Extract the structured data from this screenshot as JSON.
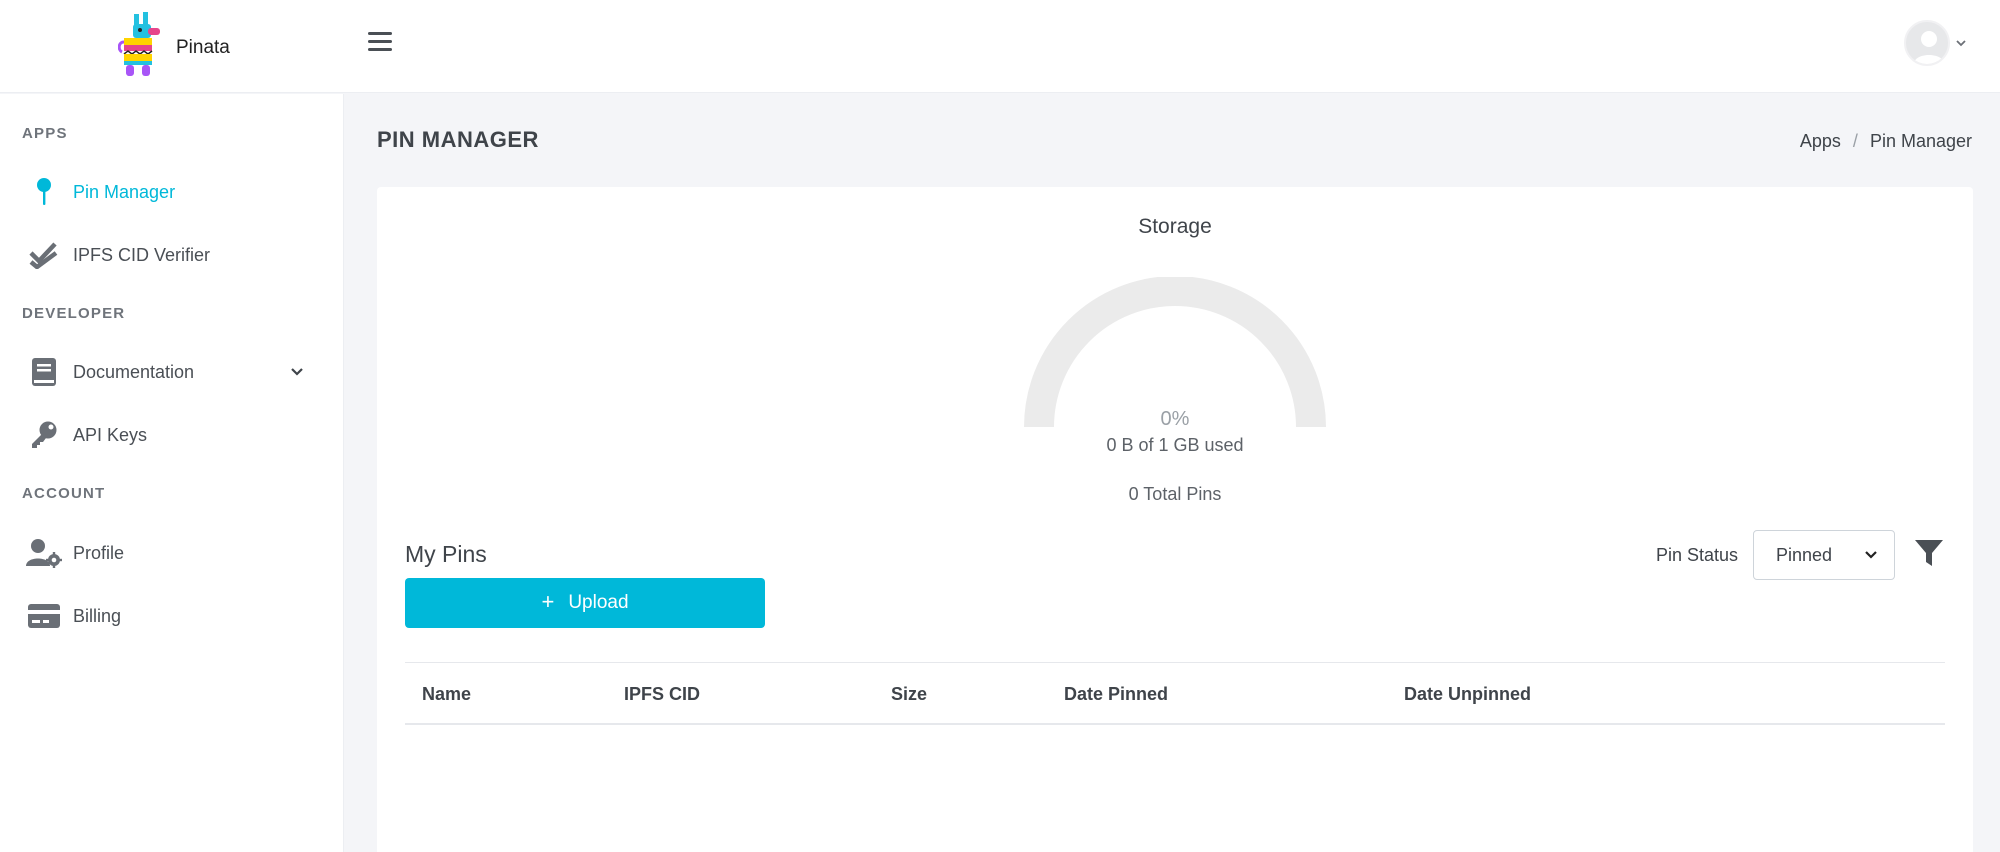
{
  "header": {
    "brand_name": "Pinata",
    "colors": {
      "background": "#ffffff",
      "accent": "#00b8d9"
    }
  },
  "sidebar": {
    "sections": [
      {
        "title": "APPS",
        "items": [
          {
            "label": "Pin Manager",
            "icon": "pin-icon",
            "active": true
          },
          {
            "label": "IPFS CID Verifier",
            "icon": "double-check-icon",
            "active": false
          }
        ]
      },
      {
        "title": "DEVELOPER",
        "items": [
          {
            "label": "Documentation",
            "icon": "book-icon",
            "active": false,
            "expandable": true
          },
          {
            "label": "API Keys",
            "icon": "key-icon",
            "active": false
          }
        ]
      },
      {
        "title": "ACCOUNT",
        "items": [
          {
            "label": "Profile",
            "icon": "user-gear-icon",
            "active": false
          },
          {
            "label": "Billing",
            "icon": "credit-card-icon",
            "active": false
          }
        ]
      }
    ]
  },
  "main": {
    "page_title": "PIN MANAGER",
    "breadcrumb": [
      "Apps",
      "Pin Manager"
    ],
    "storage": {
      "title": "Storage",
      "percent_text": "0%",
      "percent_value": 0,
      "used_text": "0 B of 1 GB used",
      "total_pins_text": "0 Total Pins"
    },
    "pins": {
      "title": "My Pins",
      "upload_label": "Upload",
      "pin_status_label": "Pin Status",
      "pin_status_value": "Pinned",
      "columns": [
        "Name",
        "IPFS CID",
        "Size",
        "Date Pinned",
        "Date Unpinned"
      ],
      "rows": []
    }
  }
}
